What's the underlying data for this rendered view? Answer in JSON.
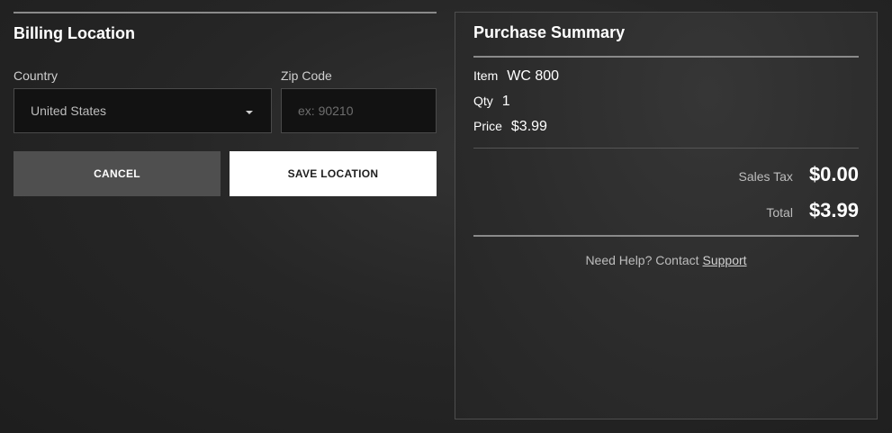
{
  "billing": {
    "title": "Billing Location",
    "country": {
      "label": "Country",
      "selected": "United States"
    },
    "zip": {
      "label": "Zip Code",
      "placeholder": "ex: 90210",
      "value": ""
    },
    "cancel_label": "CANCEL",
    "save_label": "SAVE LOCATION"
  },
  "summary": {
    "title": "Purchase Summary",
    "items": [
      {
        "label": "Item",
        "value": "WC 800"
      },
      {
        "label": "Qty",
        "value": "1"
      },
      {
        "label": "Price",
        "value": "$3.99"
      }
    ],
    "sales_tax_label": "Sales Tax",
    "sales_tax_value": "$0.00",
    "total_label": "Total",
    "total_value": "$3.99",
    "help_text": "Need Help? Contact",
    "help_link": "Support"
  },
  "colors": {
    "background": "#222222",
    "cancel_button": "#4f4f4f",
    "save_button": "#ffffff",
    "input_background": "#121212"
  },
  "icons": {
    "country_dropdown": "caret-down-icon"
  }
}
